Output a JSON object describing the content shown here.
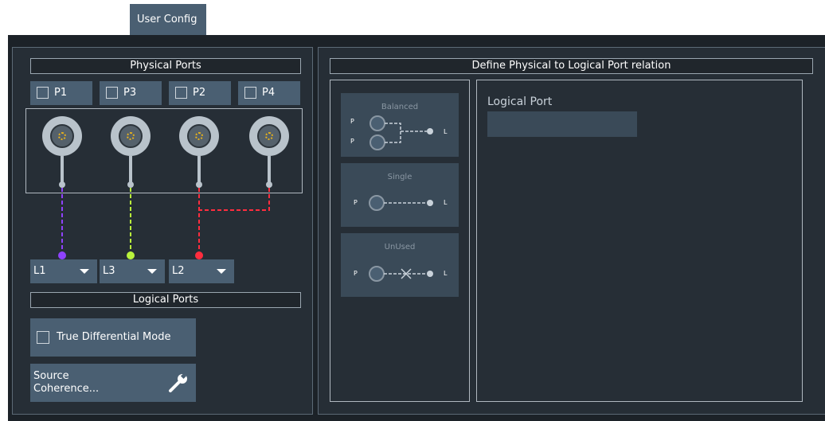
{
  "tabs": [
    {
      "label": "User Config"
    }
  ],
  "physical": {
    "header": "Physical Ports",
    "ports": [
      {
        "label": "P1",
        "checked": false
      },
      {
        "label": "P3",
        "checked": false
      },
      {
        "label": "P2",
        "checked": false
      },
      {
        "label": "P4",
        "checked": false
      }
    ],
    "line_colors": [
      "#8f42ff",
      "#b9f23c",
      "#ff2d3e",
      "#ff2d3e"
    ]
  },
  "logical": {
    "header": "Logical Ports",
    "dropdowns": [
      {
        "value": "L1"
      },
      {
        "value": "L3"
      },
      {
        "value": "L2"
      }
    ],
    "true_diff": {
      "label": "True Differential Mode",
      "checked": false
    },
    "source_coherence": {
      "line1": "Source",
      "line2": "Coherence...",
      "icon": "wrench-icon"
    }
  },
  "relation": {
    "header": "Define Physical to Logical Port relation",
    "options": [
      {
        "title": "Balanced",
        "p": "P",
        "l": "L"
      },
      {
        "title": "Single",
        "p": "P",
        "l": "L"
      },
      {
        "title": "UnUsed",
        "p": "P",
        "l": "L"
      }
    ],
    "logical_port_label": "Logical Port",
    "logical_port_value": ""
  },
  "colors": {
    "button": "#4a5f72",
    "panel": "#262e36",
    "background": "#1c2228",
    "connector_core": "#e8b21c"
  }
}
